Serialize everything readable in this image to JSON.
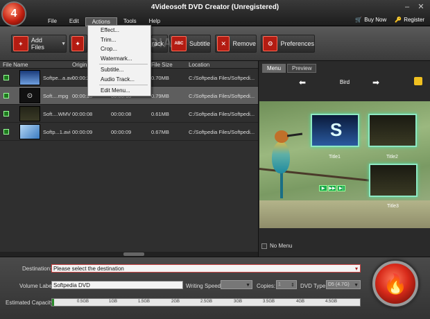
{
  "window": {
    "title": "4Videosoft DVD Creator (Unregistered)",
    "minimize": "–",
    "close": "✕"
  },
  "menubar": {
    "items": [
      "File",
      "Edit",
      "Actions",
      "Tools",
      "Help"
    ],
    "buy_now": "Buy Now",
    "register": "Register"
  },
  "actions_menu": {
    "items": [
      "Effect...",
      "Trim...",
      "Crop...",
      "Watermark...",
      "Subtitle...",
      "Audio Track...",
      "Edit Menu..."
    ]
  },
  "toolbar": {
    "add_files": "Add Files",
    "track": "rack",
    "subtitle": "Subtitle",
    "remove": "Remove",
    "preferences": "Preferences",
    "watermark": "OFTPEDIA"
  },
  "filelist": {
    "columns": [
      "File Name",
      "Origin",
      "File Size",
      "Location"
    ],
    "rows": [
      {
        "name": "Softpe...a.avi",
        "origin": "00:00:2",
        "length": "",
        "size": "0.70MB",
        "location": "C:/Softpedia Files/Softpedi..."
      },
      {
        "name": "Soft....mpg",
        "origin": "00:00:18",
        "length": "00:00:18",
        "size": "0.79MB",
        "location": "C:/Softpedia Files/Softpedi..."
      },
      {
        "name": "Soft....WMV",
        "origin": "00:00:08",
        "length": "00:00:08",
        "size": "0.61MB",
        "location": "C:/Softpedia Files/Softpedi..."
      },
      {
        "name": "Softp...1.avi",
        "origin": "00:00:09",
        "length": "00:00:09",
        "size": "0.67MB",
        "location": "C:/Softpedia Files/Softpedi..."
      }
    ]
  },
  "preview": {
    "tabs": [
      "Menu",
      "Preview"
    ],
    "menu_title": "Bird",
    "titles": [
      "Title1",
      "Title2",
      "Title3"
    ],
    "no_menu": "No Menu"
  },
  "bottom": {
    "destination_label": "Destination:",
    "destination_value": "Please select the destination",
    "volume_label": "Volume Label:",
    "volume_value": "Softpedia DVD",
    "writing_speed_label": "Writing Speed:",
    "copies_label": "Copies:",
    "copies_value": "1",
    "dvd_type_label": "DVD Type:",
    "dvd_type_value": "D5 (4.7G)",
    "capacity_label": "Estimated Capacity:",
    "capacity_ticks": [
      "0.5GB",
      "1GB",
      "1.5GB",
      "2GB",
      "2.5GB",
      "3GB",
      "3.5GB",
      "4GB",
      "4.5GB"
    ]
  },
  "icons": {
    "add": "plus-icon",
    "subtitle": "abc-icon",
    "remove": "x-icon",
    "preferences": "gear-icon",
    "burn": "flame-icon"
  }
}
